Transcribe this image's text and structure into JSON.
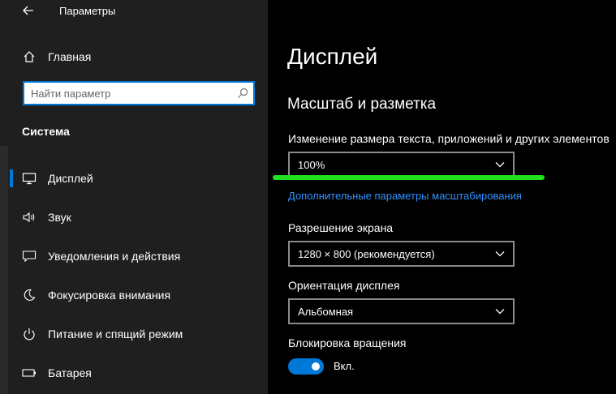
{
  "window": {
    "title": "Параметры"
  },
  "sidebar": {
    "home_label": "Главная",
    "search_placeholder": "Найти параметр",
    "section_title": "Система",
    "items": [
      {
        "label": "Дисплей",
        "icon": "monitor-icon",
        "selected": true
      },
      {
        "label": "Звук",
        "icon": "speaker-icon"
      },
      {
        "label": "Уведомления и действия",
        "icon": "notification-icon"
      },
      {
        "label": "Фокусировка внимания",
        "icon": "moon-icon"
      },
      {
        "label": "Питание и спящий режим",
        "icon": "power-icon"
      },
      {
        "label": "Батарея",
        "icon": "battery-icon"
      }
    ]
  },
  "main": {
    "title": "Дисплей",
    "scale_section": {
      "title": "Масштаб и разметка",
      "scale_label": "Изменение размера текста, приложений и других элементов",
      "scale_value": "100%",
      "advanced_link": "Дополнительные параметры масштабирования",
      "resolution_label": "Разрешение экрана",
      "resolution_value": "1280 × 800 (рекомендуется)",
      "orientation_label": "Ориентация дисплея",
      "orientation_value": "Альбомная",
      "rotation_lock_label": "Блокировка вращения",
      "rotation_lock_state": "Вкл."
    }
  },
  "colors": {
    "accent": "#0078d7",
    "link": "#3391ff",
    "highlight": "#22e01f",
    "sidebar_bg": "#1f1f1f",
    "main_bg": "#000000"
  }
}
